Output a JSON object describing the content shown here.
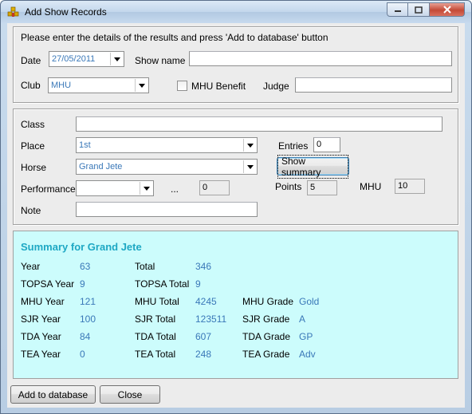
{
  "window": {
    "title": "Add Show Records"
  },
  "details": {
    "instruction": "Please enter the details of the results and press 'Add to database' button",
    "date_label": "Date",
    "date_value": "27/05/2011",
    "show_name_label": "Show name",
    "show_name_value": "",
    "club_label": "Club",
    "club_value": "MHU",
    "mhu_benefit_label": "MHU Benefit",
    "judge_label": "Judge",
    "judge_value": ""
  },
  "entry": {
    "class_label": "Class",
    "class_value": "",
    "place_label": "Place",
    "place_value": "1st",
    "entries_label": "Entries",
    "entries_value": "0",
    "horse_label": "Horse",
    "horse_value": "Grand Jete",
    "show_summary_label": "Show summary",
    "performance_label": "Performance",
    "performance_value": "",
    "ellipsis": "...",
    "perf_points_value": "0",
    "points_label": "Points",
    "points_value": "5",
    "mhu_label": "MHU",
    "mhu_value": "10",
    "note_label": "Note",
    "note_value": ""
  },
  "summary": {
    "title": "Summary for Grand Jete",
    "rows": [
      {
        "l1": "Year",
        "v1": "63",
        "l2": "Total",
        "v2": "346",
        "l3": "",
        "v3": ""
      },
      {
        "l1": "TOPSA Year",
        "v1": "9",
        "l2": "TOPSA Total",
        "v2": "9",
        "l3": "",
        "v3": ""
      },
      {
        "l1": "MHU Year",
        "v1": "121",
        "l2": "MHU Total",
        "v2": "4245",
        "l3": "MHU Grade",
        "v3": "Gold"
      },
      {
        "l1": "SJR Year",
        "v1": "100",
        "l2": "SJR Total",
        "v2": "123511",
        "l3": "SJR Grade",
        "v3": "A"
      },
      {
        "l1": "TDA Year",
        "v1": "84",
        "l2": "TDA Total",
        "v2": "607",
        "l3": "TDA Grade",
        "v3": "GP"
      },
      {
        "l1": "TEA Year",
        "v1": "0",
        "l2": "TEA Total",
        "v2": "248",
        "l3": "TEA Grade",
        "v3": "Adv"
      }
    ]
  },
  "actions": {
    "add_label": "Add to database",
    "close_label": "Close"
  },
  "colors": {
    "summary_bg": "#ccfcfc",
    "summary_title": "#1ea8c4",
    "summary_value": "#3a78b8"
  }
}
